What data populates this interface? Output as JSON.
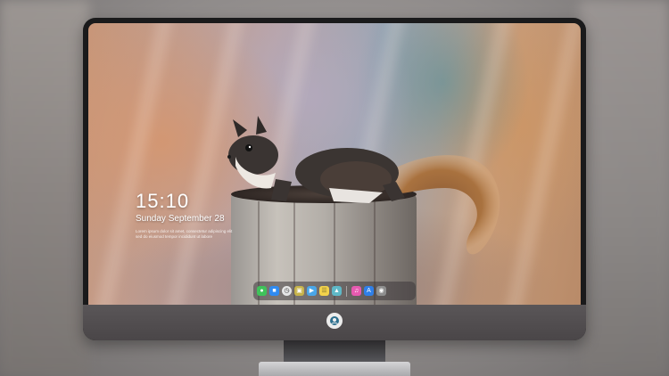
{
  "lock_screen": {
    "time": "15:10",
    "date": "Sunday September 28",
    "note": "Lorem ipsum dolor sit amet, consectetur adipiscing elit sed do eiusmod tempor incididunt ut labore"
  },
  "dock": {
    "icons": [
      {
        "name": "messages-icon",
        "color": "#3fc35a"
      },
      {
        "name": "files-icon",
        "color": "#2f8bf0"
      },
      {
        "name": "clock-icon",
        "color": "#e6e6e6"
      },
      {
        "name": "photo-viewer-icon",
        "color": "#c7b34a"
      },
      {
        "name": "video-icon",
        "color": "#4aa6e8"
      },
      {
        "name": "notes-icon",
        "color": "#f2d24b"
      },
      {
        "name": "gallery-icon",
        "color": "#5fb8c7"
      },
      {
        "name": "music-icon",
        "color": "#e65ab0"
      },
      {
        "name": "app-store-icon",
        "color": "#2f7fe8"
      },
      {
        "name": "camera-icon",
        "color": "#9a9a9a"
      }
    ]
  },
  "colors": {
    "bezel": "#1a1a1b",
    "chin": "#4f4b4d",
    "stand": "#c6c6c8"
  }
}
